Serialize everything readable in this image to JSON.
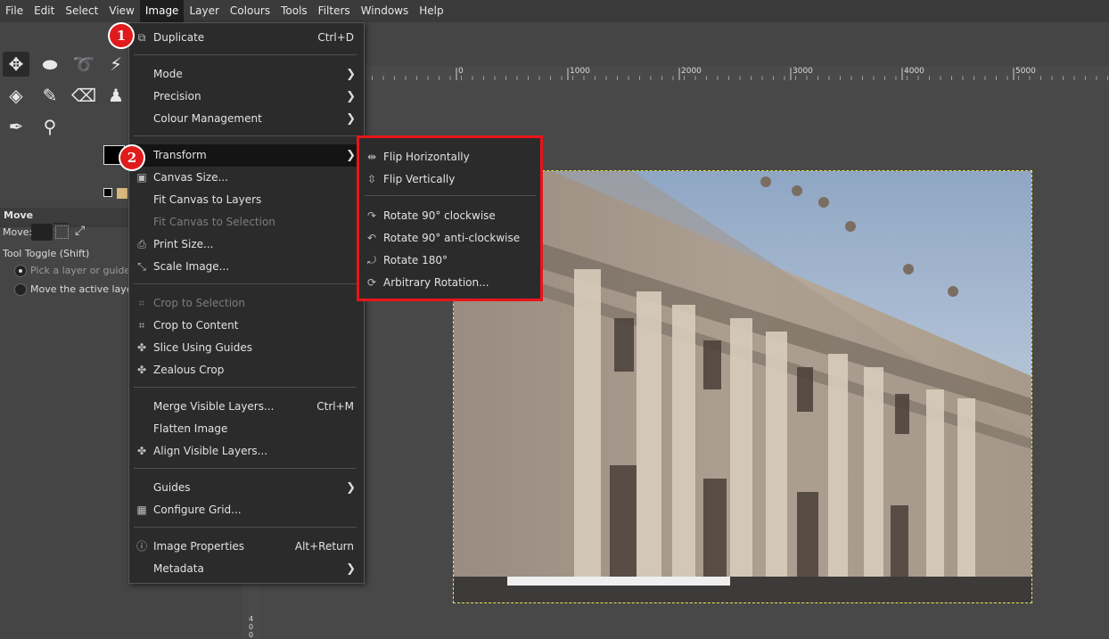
{
  "menubar": {
    "items": [
      "File",
      "Edit",
      "Select",
      "View",
      "Image",
      "Layer",
      "Colours",
      "Tools",
      "Filters",
      "Windows",
      "Help"
    ],
    "active": "Image"
  },
  "toolbox": {
    "options_title": "Move",
    "move_label": "Move:",
    "toggle_label": "Tool Toggle  (Shift)",
    "radio_pick": "Pick a layer or guide",
    "radio_move": "Move the active layer"
  },
  "rulers": {
    "h_ticks": [
      "0",
      "1000",
      "2000",
      "3000",
      "4000",
      "5000"
    ],
    "v_digit": "4\n0\n0"
  },
  "image_menu": {
    "duplicate": {
      "label": "Duplicate",
      "shortcut": "Ctrl+D"
    },
    "mode": "Mode",
    "precision": "Precision",
    "colour_management": "Colour Management",
    "transform": "Transform",
    "canvas_size": "Canvas Size...",
    "fit_canvas_layers": "Fit Canvas to Layers",
    "fit_canvas_selection": "Fit Canvas to Selection",
    "print_size": "Print Size...",
    "scale_image": "Scale Image...",
    "crop_selection": "Crop to Selection",
    "crop_content": "Crop to Content",
    "slice_guides": "Slice Using Guides",
    "zealous_crop": "Zealous Crop",
    "merge_visible": {
      "label": "Merge Visible Layers...",
      "shortcut": "Ctrl+M"
    },
    "flatten": "Flatten Image",
    "align_visible": "Align Visible Layers...",
    "guides": "Guides",
    "configure_grid": "Configure Grid...",
    "image_properties": {
      "label": "Image Properties",
      "shortcut": "Alt+Return"
    },
    "metadata": "Metadata"
  },
  "transform_menu": {
    "flip_h": "Flip Horizontally",
    "flip_v": "Flip Vertically",
    "rot_cw": "Rotate 90° clockwise",
    "rot_ccw": "Rotate 90° anti-clockwise",
    "rot_180": "Rotate 180°",
    "arbitrary": "Arbitrary Rotation..."
  },
  "badges": {
    "one": "1",
    "two": "2"
  },
  "colors": {
    "highlight_border": "#e8141a",
    "badge": "#e11b1b",
    "menu_bg": "#2b2b2b"
  }
}
